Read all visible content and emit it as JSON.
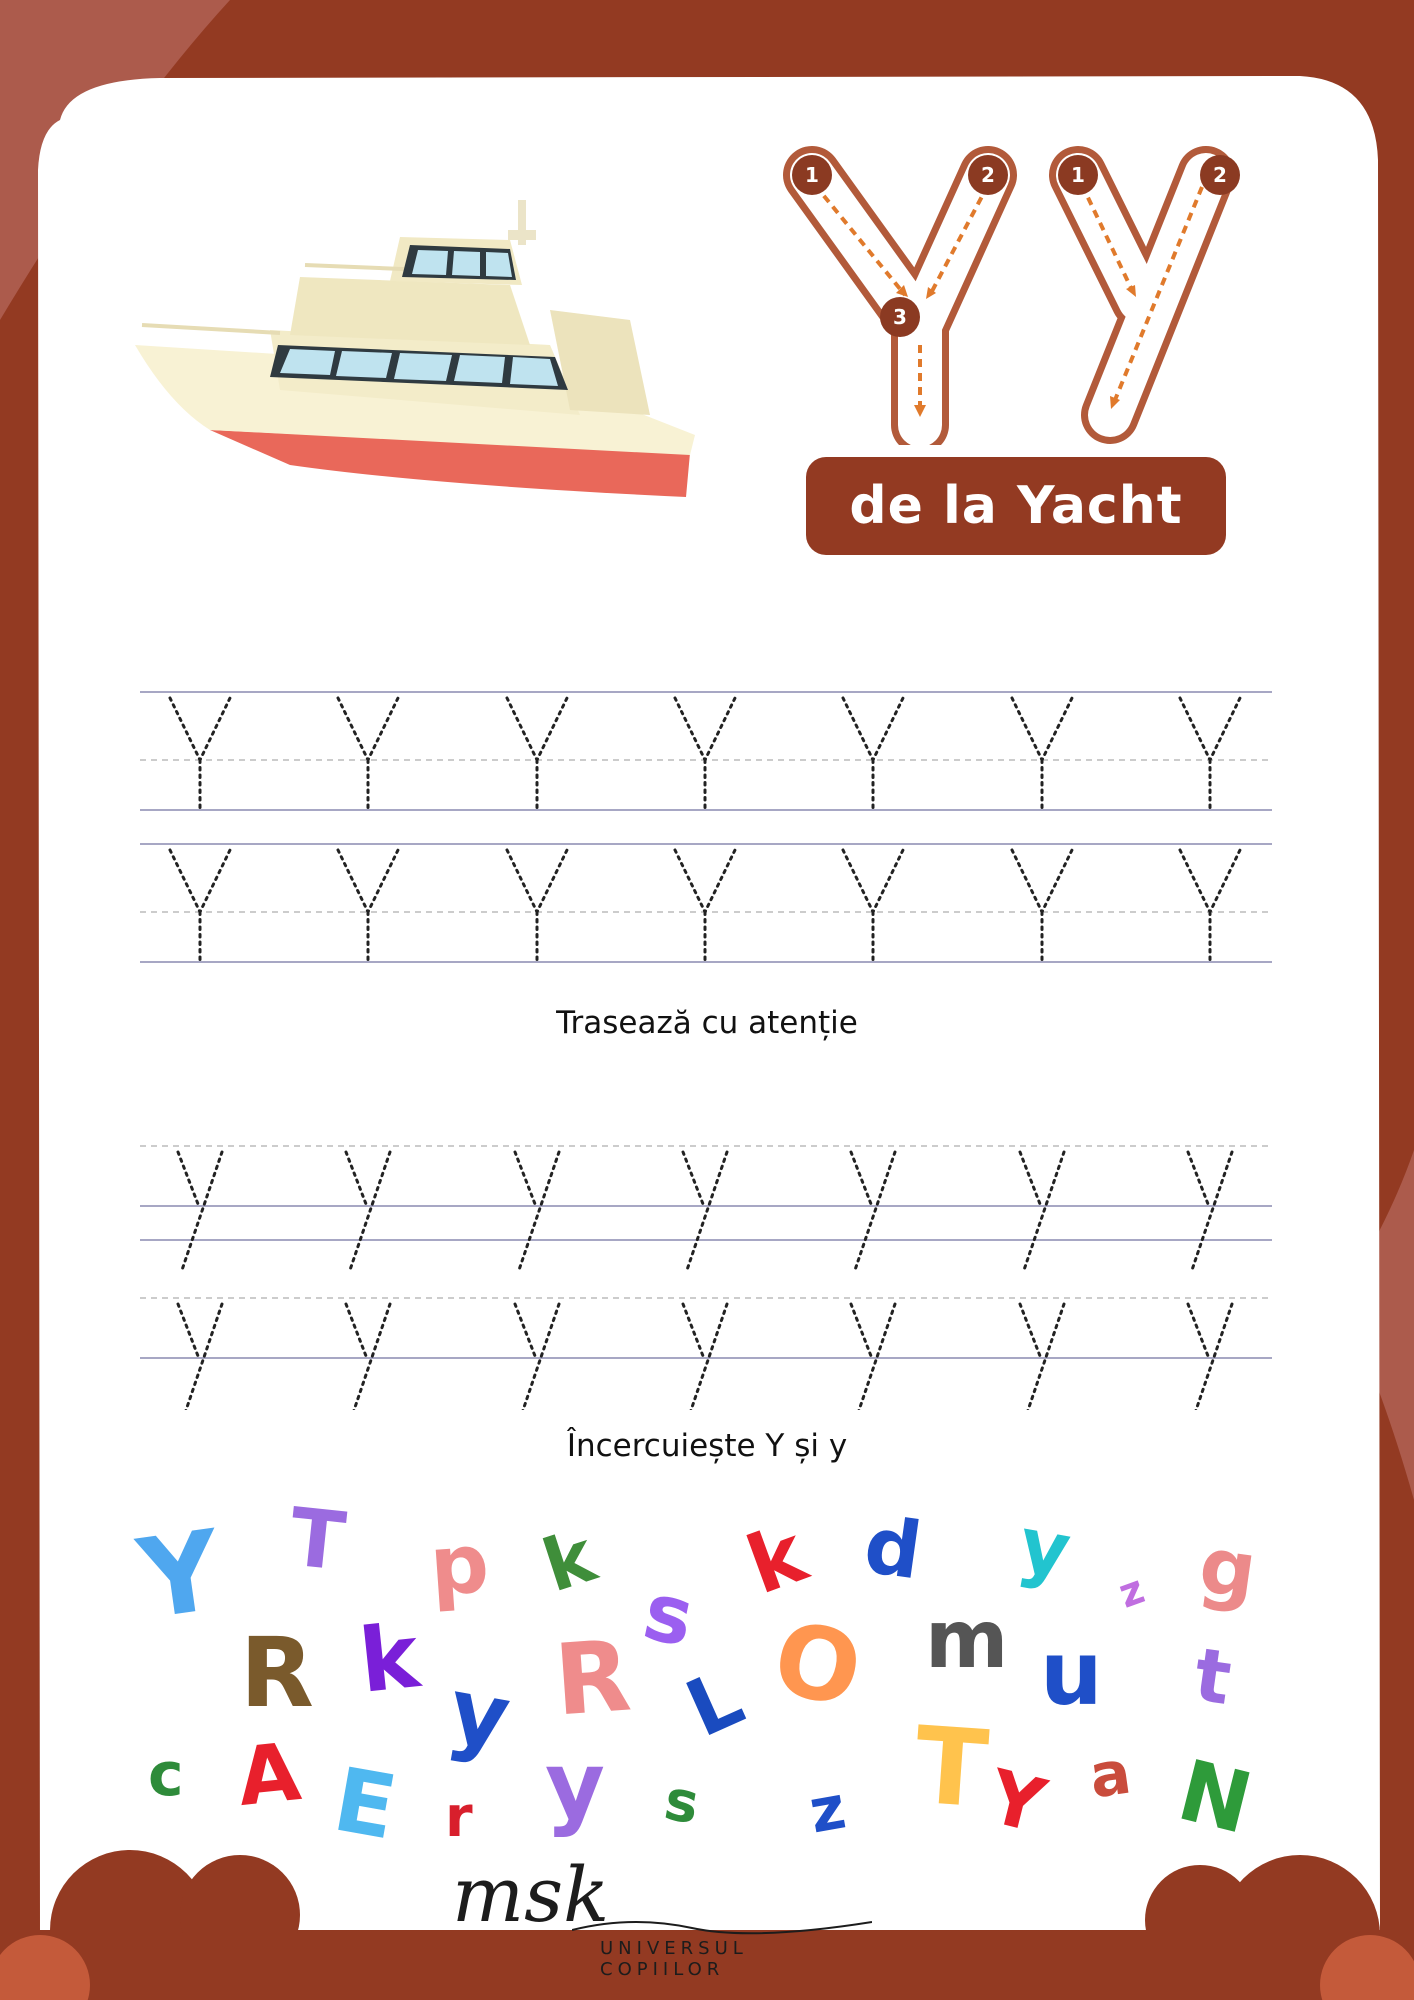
{
  "header": {
    "banner_text": "de la Yacht",
    "stroke_numbers": {
      "upper_1": "1",
      "upper_2": "2",
      "upper_3": "3",
      "lower_1": "1",
      "lower_2": "2"
    }
  },
  "sections": {
    "trace_caption": "Trasează cu atenție",
    "circle_caption": "Încercuiește Y și y"
  },
  "letter_grid": [
    {
      "ch": "Y",
      "color": "#4fa7ef"
    },
    {
      "ch": "T",
      "color": "#9b6be0"
    },
    {
      "ch": "p",
      "color": "#ef8c8c"
    },
    {
      "ch": "k",
      "color": "#3f8e3a"
    },
    {
      "ch": "s",
      "color": "#9b5ff0"
    },
    {
      "ch": "k",
      "color": "#e8202c"
    },
    {
      "ch": "d",
      "color": "#1f4fc8"
    },
    {
      "ch": "y",
      "color": "#22c4cf"
    },
    {
      "ch": "z",
      "color": "#c06ee0"
    },
    {
      "ch": "g",
      "color": "#ec8a8a"
    },
    {
      "ch": "R",
      "color": "#7a5a2c"
    },
    {
      "ch": "k",
      "color": "#7a1fd8"
    },
    {
      "ch": "y",
      "color": "#1f4fc8"
    },
    {
      "ch": "R",
      "color": "#ef8c8c"
    },
    {
      "ch": "L",
      "color": "#1a4bbf"
    },
    {
      "ch": "O",
      "color": "#ff9650"
    },
    {
      "ch": "m",
      "color": "#555555"
    },
    {
      "ch": "u",
      "color": "#1f4fc8"
    },
    {
      "ch": "t",
      "color": "#9b6be0"
    },
    {
      "ch": "c",
      "color": "#2e8b3a"
    },
    {
      "ch": "A",
      "color": "#e8202c"
    },
    {
      "ch": "E",
      "color": "#4fb8f0"
    },
    {
      "ch": "r",
      "color": "#d81f2c"
    },
    {
      "ch": "y",
      "color": "#9b6be0"
    },
    {
      "ch": "s",
      "color": "#2e8b3a"
    },
    {
      "ch": "z",
      "color": "#1f4fc8"
    },
    {
      "ch": "T",
      "color": "#ffc34d"
    },
    {
      "ch": "Y",
      "color": "#e8202c"
    },
    {
      "ch": "a",
      "color": "#c94c3c"
    },
    {
      "ch": "N",
      "color": "#2e9b3a"
    }
  ],
  "branding": {
    "logo": "msk",
    "tagline": "UNIVERSUL COPIILOR"
  },
  "colors": {
    "border": "#933a22",
    "accent": "#e07a2c",
    "hull": "#e9685a",
    "paper": "#ffffff"
  }
}
